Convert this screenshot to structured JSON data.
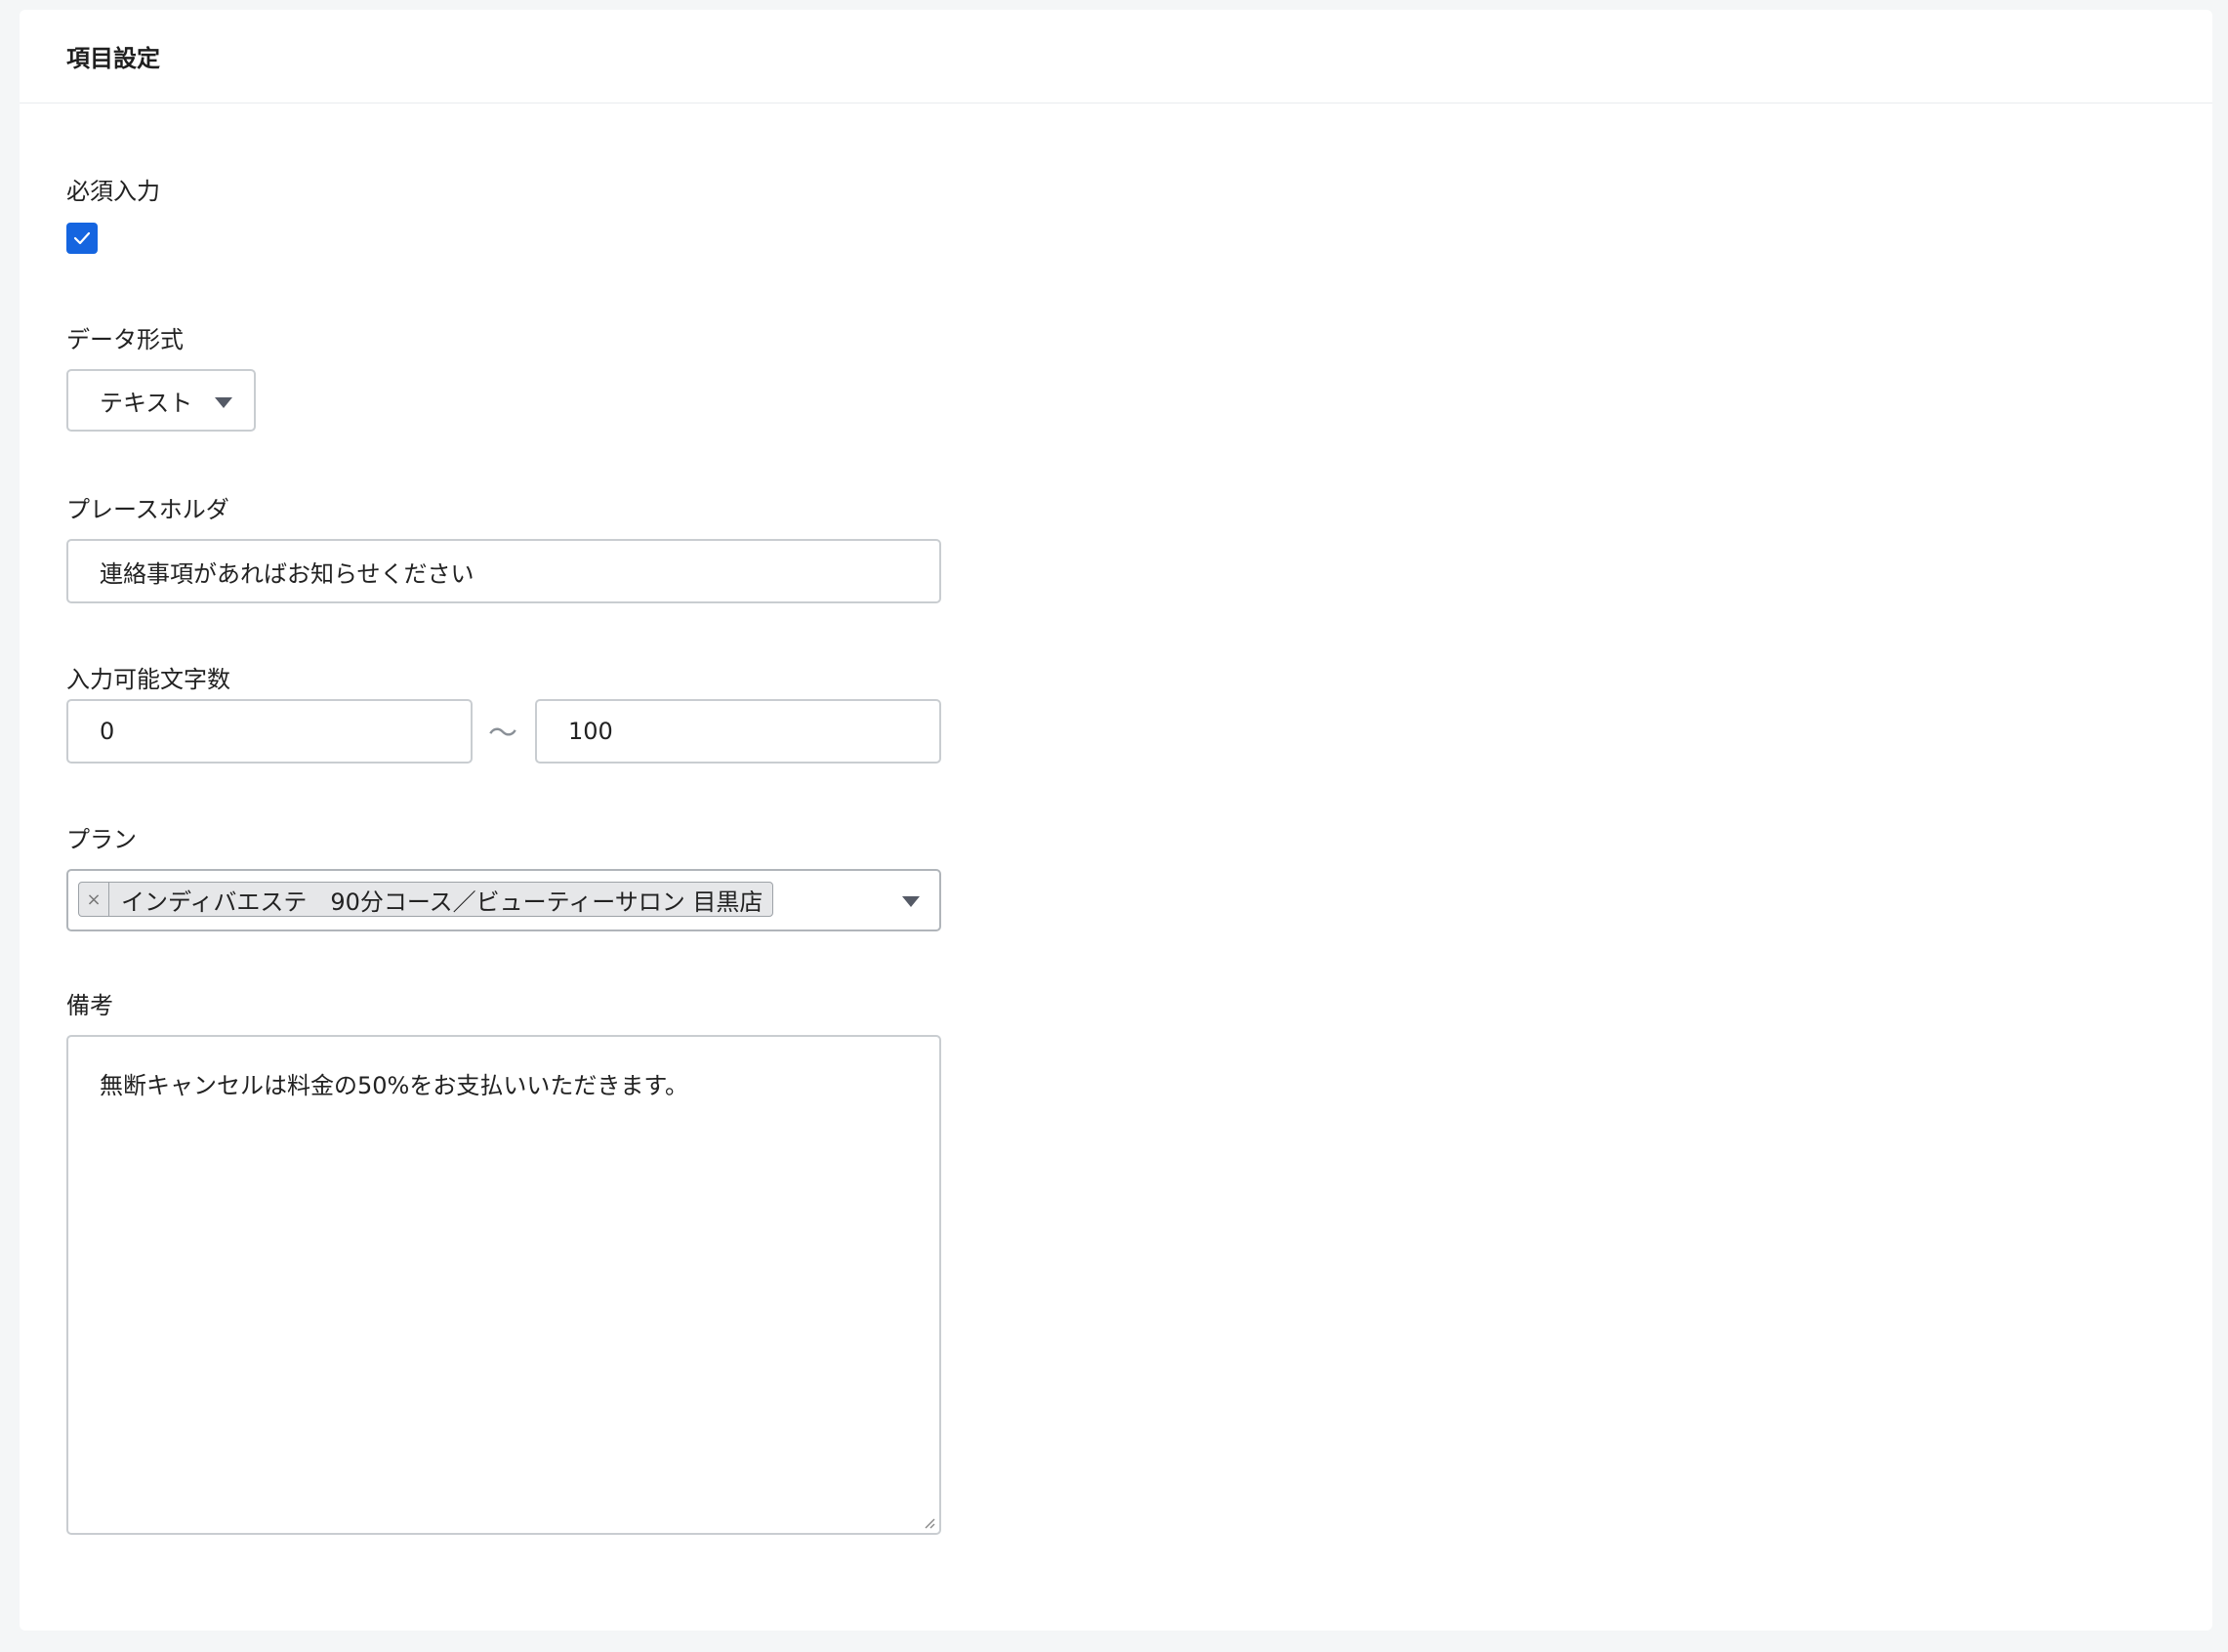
{
  "header": {
    "title": "項目設定"
  },
  "required": {
    "label": "必須入力",
    "checked": true
  },
  "data_format": {
    "label": "データ形式",
    "value": "テキスト"
  },
  "placeholder_field": {
    "label": "プレースホルダ",
    "value": "連絡事項があればお知らせください"
  },
  "char_limit": {
    "label": "入力可能文字数",
    "min": "0",
    "separator": "〜",
    "max": "100"
  },
  "plan": {
    "label": "プラン",
    "tags": [
      {
        "remove": "×",
        "label": "インディバエステ　90分コース／ビューティーサロン 目黒店"
      }
    ]
  },
  "notes": {
    "label": "備考",
    "value": "無断キャンセルは料金の50%をお支払いいただきます。"
  },
  "colors": {
    "accent": "#1565e0",
    "border": "#c9cdd1",
    "background": "#f4f6f7"
  }
}
